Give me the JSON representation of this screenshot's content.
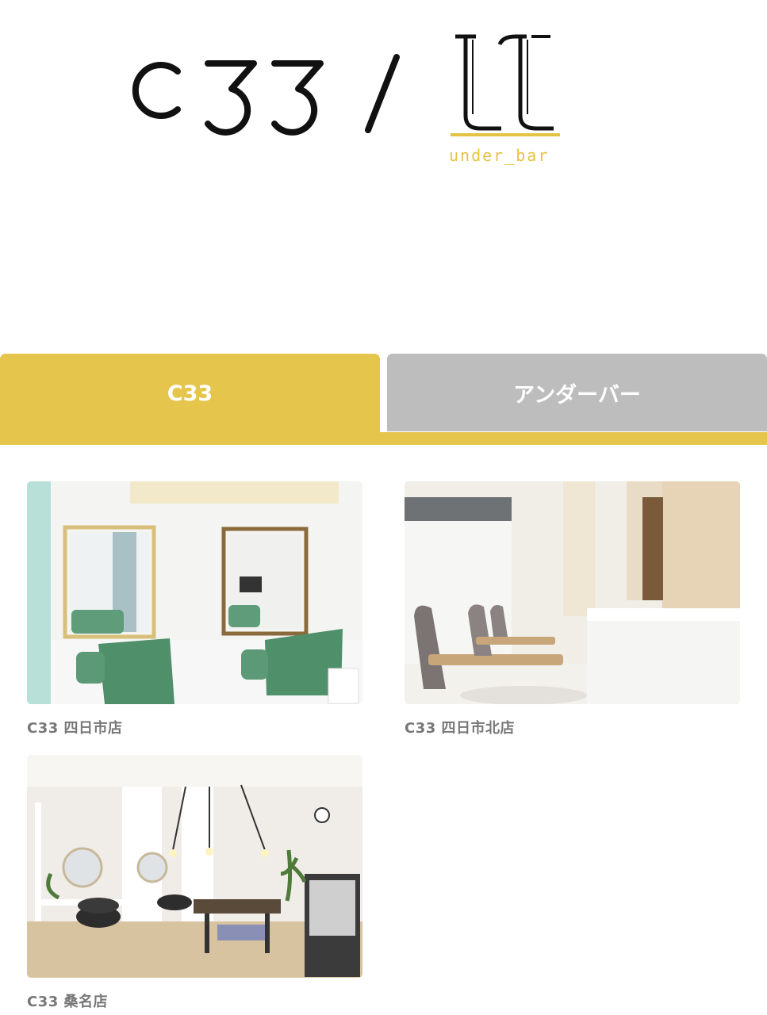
{
  "header": {
    "logo_c33_text": "C33",
    "logo_u_sub": "under_bar"
  },
  "tabs": [
    {
      "label": "C33",
      "active": true
    },
    {
      "label": "アンダーバー",
      "active": false
    }
  ],
  "colors": {
    "accent": "#e5c54c",
    "tab_inactive": "#bdbdbd",
    "label": "#777777"
  },
  "stores": [
    {
      "name": "C33 四日市店",
      "image": "salon-green-chairs-photo"
    },
    {
      "name": "C33 四日市北店",
      "image": "salon-window-chairs-photo"
    },
    {
      "name": "C33 桑名店",
      "image": "salon-pendant-lights-photo"
    }
  ]
}
